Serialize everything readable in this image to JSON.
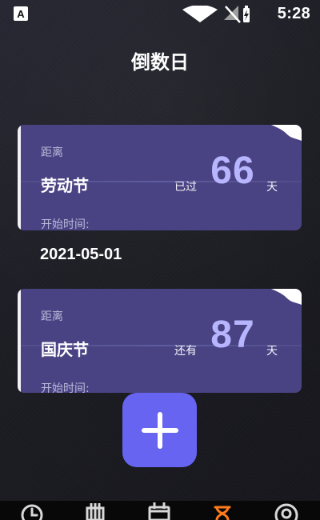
{
  "status_bar": {
    "app_icon_text": "A",
    "time": "5:28",
    "icons": [
      "wifi-icon",
      "no-signal-icon",
      "battery-charging-icon"
    ]
  },
  "page": {
    "title": "倒数日"
  },
  "events": [
    {
      "distance_label": "距离",
      "name": "劳动节",
      "status": "已过",
      "days": "66",
      "unit": "天",
      "start_label": "开始时间:",
      "start_date": "2021-05-01"
    },
    {
      "distance_label": "距离",
      "name": "国庆节",
      "status": "还有",
      "days": "87",
      "unit": "天",
      "start_label": "开始时间:"
    }
  ],
  "actions": {
    "add_icon": "plus-icon"
  },
  "bottom_nav": {
    "items": [
      {
        "icon": "clock-icon"
      },
      {
        "icon": "calendar-grid-icon"
      },
      {
        "icon": "calendar-icon"
      },
      {
        "icon": "hourglass-icon",
        "active": true
      },
      {
        "icon": "profile-icon"
      }
    ]
  },
  "colors": {
    "background": "#1b1b22",
    "card": "#4a4383",
    "accent_number": "#b8b5ff",
    "add_button": "#6664f0",
    "active_nav": "#ff7a1a"
  }
}
